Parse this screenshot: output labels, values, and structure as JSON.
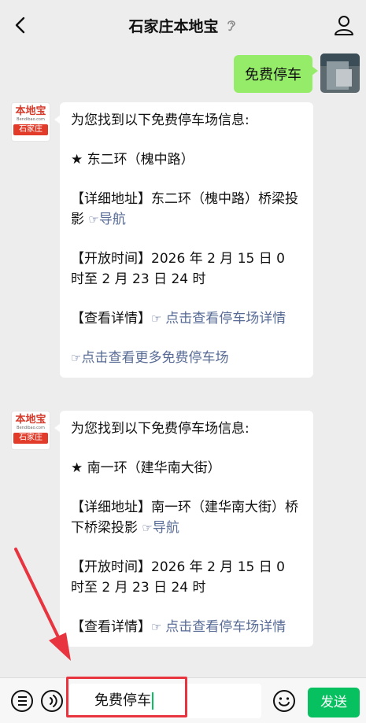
{
  "header": {
    "title": "石家庄本地宝"
  },
  "outgoing": {
    "text": "免费停车"
  },
  "logo": {
    "main": "本地宝",
    "domain": "Bendibao.com",
    "city": "石家庄"
  },
  "messages": [
    {
      "intro": "为您找到以下免费停车场信息:",
      "name": "★ 东二环（槐中路）",
      "address_label": "【详细地址】",
      "address": "东二环（槐中路）桥梁投影",
      "nav_label": "导航",
      "hours_label": "【开放时间】",
      "hours": "2026 年 2 月 15 日 0 时至 2 月 23 日 24 时",
      "detail_label": "【查看详情】",
      "detail_link": "点击查看停车场详情",
      "more_link": "点击查看更多免费停车场"
    },
    {
      "intro": "为您找到以下免费停车场信息:",
      "name": "★ 南一环（建华南大街）",
      "address_label": "【详细地址】",
      "address": "南一环（建华南大街）桥下桥梁投影",
      "nav_label": "导航",
      "hours_label": "【开放时间】",
      "hours": "2026 年 2 月 15 日 0 时至 2 月 23 日 24 时",
      "detail_label": "【查看详情】",
      "detail_link": "点击查看停车场详情"
    }
  ],
  "input": {
    "value": "免费停车"
  },
  "send_label": "发送",
  "icons": {
    "back": "chevron-left-icon",
    "ear": "ear-icon",
    "user": "user-icon",
    "menu": "menu-list-icon",
    "voice": "voice-icon",
    "emoji": "emoji-icon"
  },
  "colors": {
    "accent": "#07c160",
    "self_bubble": "#95ec69",
    "link": "#576b95",
    "annotation": "#e8343f"
  }
}
